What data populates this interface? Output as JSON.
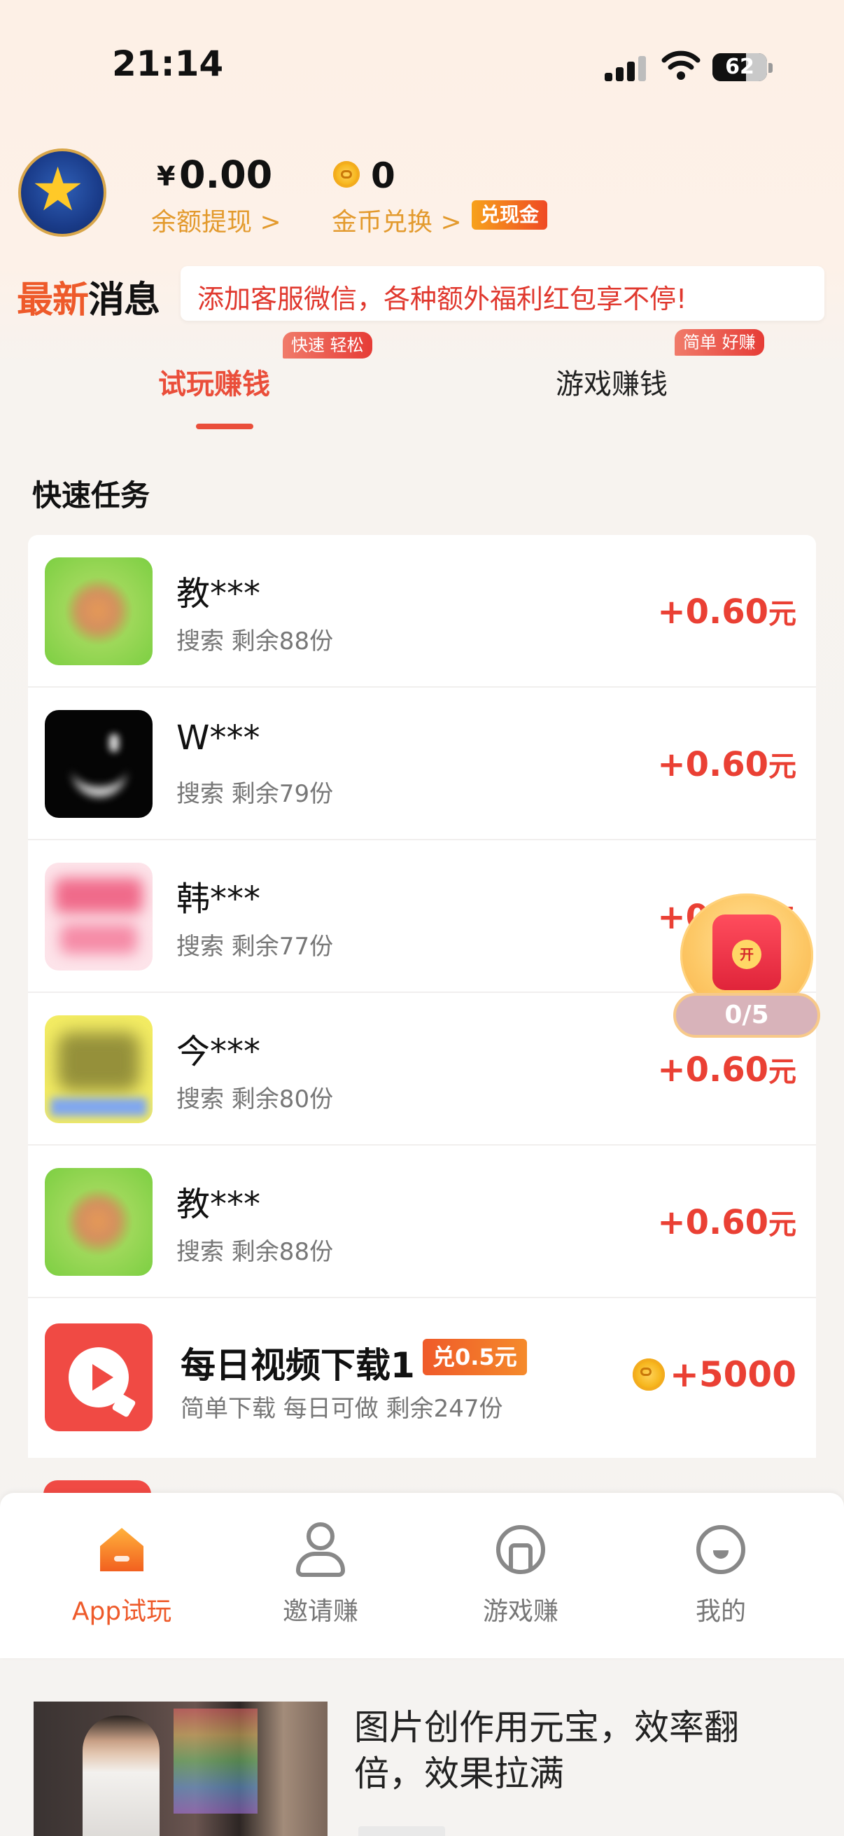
{
  "status_bar": {
    "time": "21:14",
    "battery": "62"
  },
  "header": {
    "currency_symbol": "¥",
    "balance": "0.00",
    "withdraw_label": "余额提现 >",
    "coins": "0",
    "exchange_label": "金币兑换 >",
    "cash_badge": "兑现金"
  },
  "news": {
    "label_highlight": "最新",
    "label_rest": "消息",
    "text": "添加客服微信，各种额外福利红包享不停!"
  },
  "tabs": [
    {
      "label": "试玩赚钱",
      "badge": "快速 轻松",
      "active": true
    },
    {
      "label": "游戏赚钱",
      "badge": "简单 好赚",
      "active": false
    }
  ],
  "section_title": "快速任务",
  "tasks": [
    {
      "title": "教***",
      "subtitle": "搜索  剩余88份",
      "reward": "+0.60",
      "unit": "元",
      "icon": "blurred-app-icon-green"
    },
    {
      "title": "W***",
      "subtitle": "搜索  剩余79份",
      "reward": "+0.60",
      "unit": "元",
      "icon": "blurred-app-icon-black"
    },
    {
      "title": "韩***",
      "subtitle": "搜索  剩余77份",
      "reward": "+0.60",
      "unit": "元",
      "icon": "blurred-app-icon-pink"
    },
    {
      "title": "今***",
      "subtitle": "搜索  剩余80份",
      "reward": "+0.60",
      "unit": "元",
      "icon": "blurred-app-icon-yellow"
    },
    {
      "title": "教***",
      "subtitle": "搜索  剩余88份",
      "reward": "+0.60",
      "unit": "元",
      "icon": "blurred-app-icon-green"
    }
  ],
  "video_task": {
    "title": "每日视频下载1",
    "badge": "兑0.5元",
    "subtitle": "简单下载 每日可做 剩余247份",
    "reward": "+5000",
    "icon": "video-play-icon"
  },
  "red_packet": {
    "seal": "开",
    "progress": "0/5",
    "progress_value": 0,
    "progress_total": 5
  },
  "nav": [
    {
      "label": "App试玩",
      "icon": "home-icon",
      "active": true
    },
    {
      "label": "邀请赚",
      "icon": "user-icon",
      "active": false
    },
    {
      "label": "游戏赚",
      "icon": "gamepad-icon",
      "active": false
    },
    {
      "label": "我的",
      "icon": "profile-icon",
      "active": false
    }
  ],
  "ad": {
    "text": "图片创作用元宝，效率翻倍，效果拉满"
  },
  "colors": {
    "accent": "#ea4034",
    "gold": "#e39a2d",
    "nav_active": "#ee5a2a"
  }
}
